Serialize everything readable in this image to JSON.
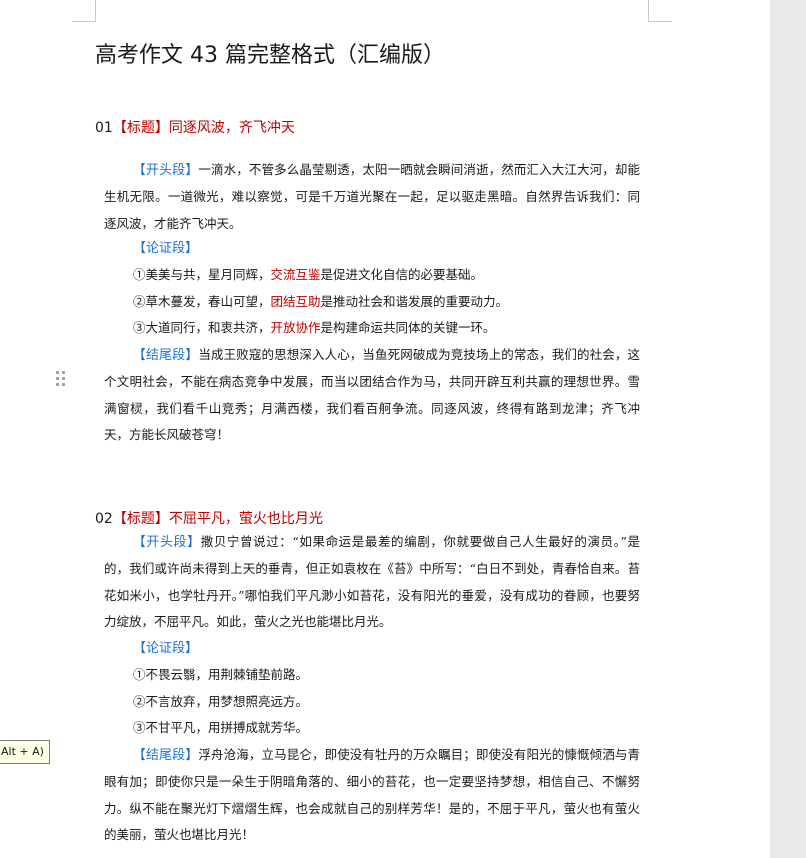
{
  "document": {
    "title": "高考作文 43 篇完整格式（汇编版）",
    "essays": [
      {
        "number": "01",
        "title_tag": "【标题】",
        "title": "同逐风波，齐飞冲天",
        "opening_label": "【开头段】",
        "opening_text": "一滴水，不管多么晶莹剔透，太阳一晒就会瞬间消逝，然而汇入大江大河，却能生机无限。一道微光，难以察觉，可是千万道光聚在一起，足以驱走黑暗。自然界告诉我们：同逐风波，才能齐飞冲天。",
        "argument_label": "【论证段】",
        "arguments": [
          {
            "prefix": "①美美与共，星月同辉，",
            "highlight": "交流互鉴",
            "suffix": "是促进文化自信的必要基础。"
          },
          {
            "prefix": "②草木蔓发，春山可望，",
            "highlight": "团结互助",
            "suffix": "是推动社会和谐发展的重要动力。"
          },
          {
            "prefix": "③大道同行，和衷共济，",
            "highlight": "开放协作",
            "suffix": "是构建命运共同体的关键一环。"
          }
        ],
        "closing_label": "【结尾段】",
        "closing_text": "当成王败寇的思想深入人心，当鱼死网破成为竞技场上的常态，我们的社会，这个文明社会，不能在病态竞争中发展，而当以团结合作为马，共同开辟互利共赢的理想世界。雪满窗棂，我们看千山竞秀；月满西楼，我们看百舸争流。同逐风波，终得有路到龙津；齐飞冲天，方能长风破苍穹！"
      },
      {
        "number": "02",
        "title_tag": "【标题】",
        "title": "不屈平凡，萤火也比月光",
        "opening_label": "【开头段】",
        "opening_text": "撒贝宁曾说过：“如果命运是最差的编剧，你就要做自己人生最好的演员。”是的，我们或许尚未得到上天的垂青，但正如袁枚在《苔》中所写：“白日不到处，青春恰自来。苔花如米小，也学牡丹开。”哪怕我们平凡渺小如苔花，没有阳光的垂爱，没有成功的眷顾，也要努力绽放，不屈平凡。如此，萤火之光也能堪比月光。",
        "argument_label": "【论证段】",
        "arguments": [
          {
            "text": "①不畏云翳，用荆棘铺垫前路。"
          },
          {
            "text": "②不言放弃，用梦想照亮远方。"
          },
          {
            "text": "③不甘平凡，用拼搏成就芳华。"
          }
        ],
        "closing_label": "【结尾段】",
        "closing_text": "浮舟沧海，立马昆仑，即使没有牡丹的万众瞩目；即使没有阳光的慷慨倾洒与青眼有加；即使你只是一朵生于阴暗角落的、细小的苔花，也一定要坚持梦想，相信自己、不懈努力。纵不能在聚光灯下熠熠生辉，也会成就自己的别样芳华！是的，不屈于平凡，萤火也有萤火的美丽，萤火也堪比月光！"
      }
    ]
  },
  "tooltip": {
    "text": "Alt + A)"
  },
  "icons": {
    "drag_handle": "drag-handle-icon"
  },
  "colors": {
    "heading_red": "#c00000",
    "label_blue": "#1f6fd1",
    "page_bg": "#ffffff",
    "gutter_bg": "#e9e9eb"
  }
}
